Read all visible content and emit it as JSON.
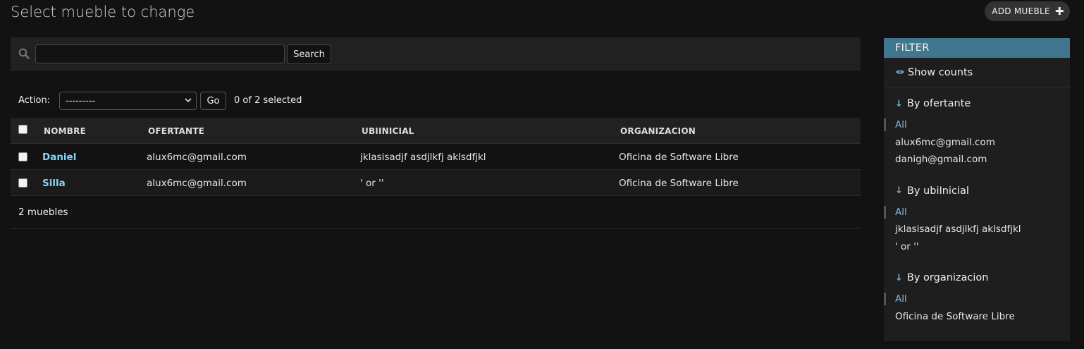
{
  "page": {
    "title": "Select mueble to change",
    "add_label": "ADD MUEBLE"
  },
  "search": {
    "value": "",
    "button": "Search"
  },
  "actions": {
    "label": "Action:",
    "selected_option": "---------",
    "go": "Go",
    "selected_count": "0 of 2 selected"
  },
  "table": {
    "headers": [
      "NOMBRE",
      "OFERTANTE",
      "UBIINICIAL",
      "ORGANIZACION"
    ],
    "rows": [
      {
        "nombre": "Daniel",
        "ofertante": "alux6mc@gmail.com",
        "ubiinicial": "jklasisadjf asdjlkfj aklsdfjkl",
        "organizacion": "Oficina de Software Libre"
      },
      {
        "nombre": "Silla",
        "ofertante": "alux6mc@gmail.com",
        "ubiinicial": "' or ''",
        "organizacion": "Oficina de Software Libre"
      }
    ]
  },
  "paginator": {
    "text": "2 muebles"
  },
  "filter": {
    "title": "FILTER",
    "show_counts": "Show counts",
    "sections": [
      {
        "title": "By ofertante",
        "options": [
          "All",
          "alux6mc@gmail.com",
          "danigh@gmail.com"
        ]
      },
      {
        "title": "By ubiInicial",
        "options": [
          "All",
          "jklasisadjf asdjlkfj aklsdfjkl",
          "' or ''"
        ]
      },
      {
        "title": "By organizacion",
        "options": [
          "All",
          "Oficina de Software Libre"
        ]
      }
    ]
  },
  "colors": {
    "accent": "#417690",
    "link": "#81d4fa",
    "background": "#121212"
  },
  "icons": {
    "search": "search-icon",
    "add": "plus-icon",
    "show_counts": "eye-icon",
    "filter_arrow": "arrow-down-icon"
  }
}
